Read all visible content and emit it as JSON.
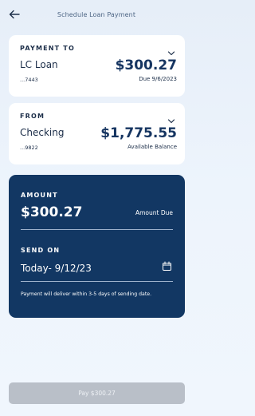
{
  "header": {
    "title": "Schedule Loan Payment",
    "back_icon": "arrow-left-icon"
  },
  "payment_to": {
    "label": "PAYMENT TO",
    "name": "LC Loan",
    "account_mask": "...7443",
    "amount": "$300.27",
    "due": "Due 9/6/2023",
    "icon": "chevron-down-icon"
  },
  "from": {
    "label": "FROM",
    "name": "Checking",
    "account_mask": "...9822",
    "amount": "$1,775.55",
    "sub": "Available Balance",
    "icon": "chevron-down-icon"
  },
  "amount_section": {
    "label": "AMOUNT",
    "value": "$300.27",
    "option": "Amount Due"
  },
  "send_on": {
    "label": "SEND ON",
    "value": "Today- 9/12/23",
    "icon": "calendar-icon",
    "note": "Payment will deliver within 3-5 days of sending date."
  },
  "footer": {
    "pay_button": "Pay $300.27"
  },
  "colors": {
    "navy": "#123763",
    "accent_text": "#163561",
    "disabled_button": "#b9bfc8"
  }
}
